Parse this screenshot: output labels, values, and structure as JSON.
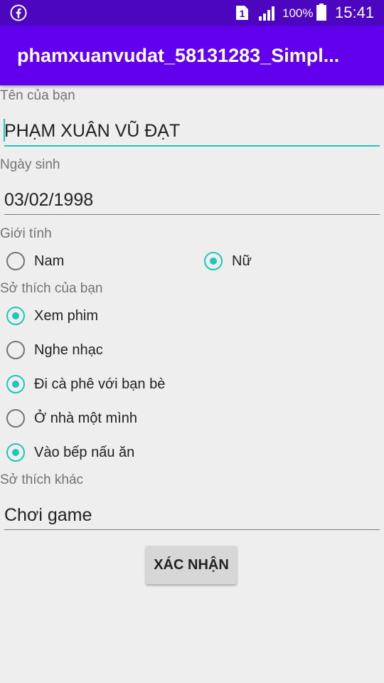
{
  "status_bar": {
    "sim_slot": "1",
    "battery_percent": "100%",
    "time": "15:41"
  },
  "app_bar": {
    "title": "phamxuanvudat_58131283_Simpl..."
  },
  "form": {
    "name_label": "Tên của bạn",
    "name_value": "PHẠM XUÂN VŨ ĐẠT",
    "dob_label": "Ngày sinh",
    "dob_value": "03/02/1998",
    "gender_label": "Giới tính",
    "gender_options": [
      {
        "label": "Nam",
        "selected": false
      },
      {
        "label": "Nữ",
        "selected": true
      }
    ],
    "hobbies_label": "Sở thích của bạn",
    "hobbies": [
      {
        "label": "Xem phim",
        "checked": true
      },
      {
        "label": "Nghe nhạc",
        "checked": false
      },
      {
        "label": "Đi cà phê với bạn bè",
        "checked": true
      },
      {
        "label": "Ở nhà một mình",
        "checked": false
      },
      {
        "label": "Vào bếp nấu ăn",
        "checked": true
      }
    ],
    "other_hobby_label": "Sở thích khác",
    "other_hobby_value": "Chơi game",
    "submit_label": "XÁC NHẬN"
  },
  "colors": {
    "status_bar": "#4d06c0",
    "app_bar": "#6200ee",
    "accent": "#1fc7b8",
    "background": "#eeeeee"
  }
}
